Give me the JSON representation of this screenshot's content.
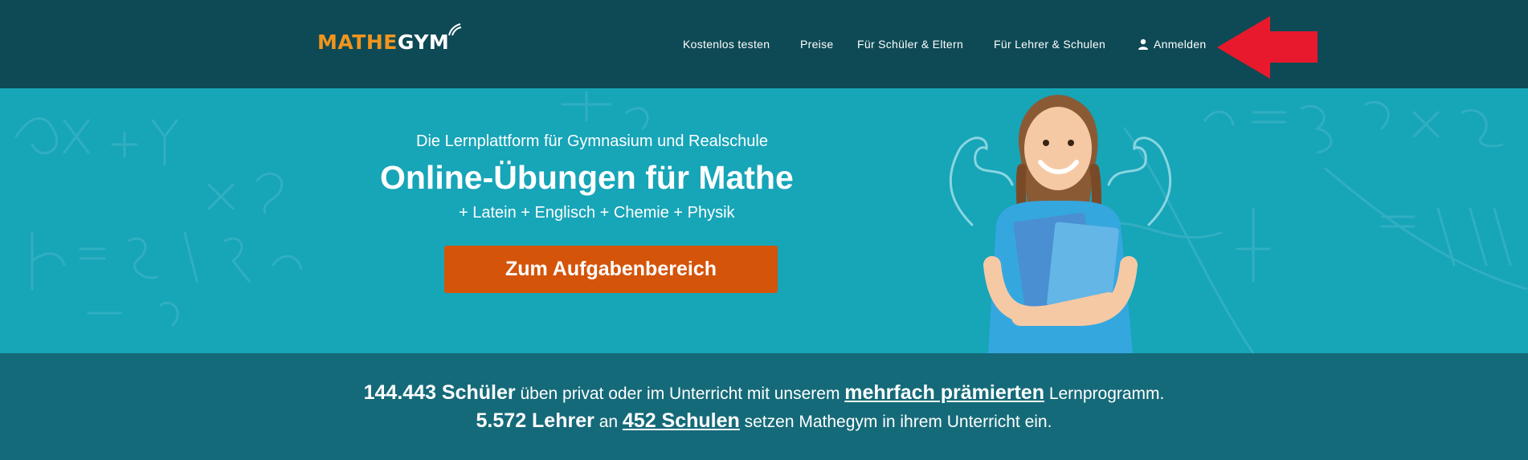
{
  "logo": {
    "part1": "MATHE",
    "part2": "GYM"
  },
  "nav": {
    "items": [
      {
        "label": "Kostenlos testen"
      },
      {
        "label": "Preise"
      },
      {
        "label": "Für Schüler & Eltern"
      },
      {
        "label": "Für Lehrer & Schulen"
      },
      {
        "label": "Anmelden",
        "icon": "user-icon"
      }
    ]
  },
  "hero": {
    "subtitle": "Die Lernplattform für Gymnasium und Realschule",
    "headline": "Online-Übungen für Mathe",
    "subjects": "+ Latein + Englisch + Chemie + Physik",
    "cta_label": "Zum Aufgabenbereich"
  },
  "stats": {
    "students_count": "144.443 Schüler",
    "students_text1": " üben privat oder im Unterricht mit unserem ",
    "award_link": "mehrfach prämierten",
    "students_text2": " Lernprogramm.",
    "teachers_count": "5.572 Lehrer",
    "teachers_text1": " an ",
    "schools_link": "452 Schulen",
    "teachers_text2": " setzen Mathegym in ihrem Unterricht ein."
  },
  "colors": {
    "header_bg": "#0e4a55",
    "hero_bg": "#17a5b8",
    "stats_bg": "#156a79",
    "cta_bg": "#d4540a",
    "logo_accent": "#f0951e",
    "arrow": "#e8192c"
  }
}
